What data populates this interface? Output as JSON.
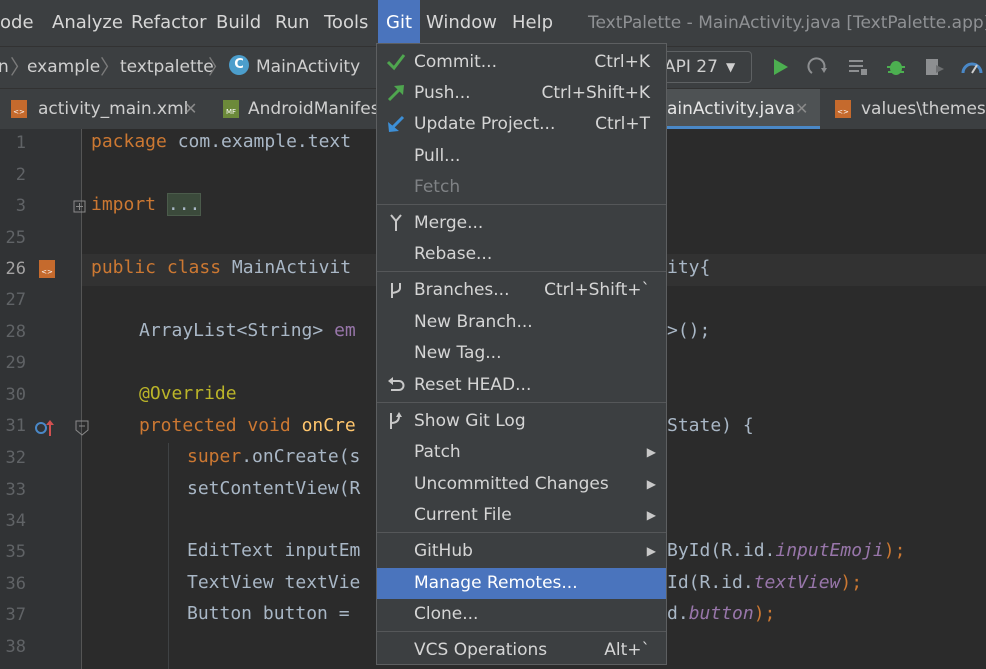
{
  "menubar": {
    "items": [
      "ode",
      "Analyze",
      "Refactor",
      "Build",
      "Run",
      "Tools",
      "Git",
      "Window",
      "Help"
    ],
    "window_title": "TextPalette - MainActivity.java [TextPalette.app] -"
  },
  "navbar": {
    "crumbs": [
      "n",
      "example",
      "textpalette",
      "MainActivity"
    ],
    "class_icon_letter": "C",
    "api_label": "API 27"
  },
  "tabs": [
    {
      "label": "activity_main.xml",
      "icon": "xml-file-icon"
    },
    {
      "label": "AndroidManifes",
      "icon": "manifest-file-icon"
    },
    {
      "label": "ainActivity.java",
      "icon": "java-file-icon",
      "active": true
    },
    {
      "label": "values\\themes",
      "icon": "xml-file-icon"
    }
  ],
  "editor": {
    "line_numbers": [
      "1",
      "2",
      "3",
      "25",
      "26",
      "27",
      "28",
      "29",
      "30",
      "31",
      "32",
      "33",
      "34",
      "35",
      "36",
      "37",
      "38"
    ],
    "lines": {
      "l1_kw": "package",
      "l1_rest": " com.example.text",
      "l3_kw": "import",
      "l3_fold": "...",
      "l26_kw": "public class",
      "l26_rest": " MainActivit",
      "l26_tail": "ity{",
      "l28": "ArrayList<String> ",
      "l28_field": "em",
      "l28_tail": ">();",
      "l30_ann": "@Override",
      "l31_kw": "protected void ",
      "l31_fn": "onCre",
      "l31_tail": "State) {",
      "l32_kw": "super",
      "l32_rest": ".onCreate(s",
      "l33": "setContentView(R",
      "l35": "EditText inputEm",
      "l35_tail1": "ById(R.id.",
      "l35_field": "inputEmoji",
      "l35_tail2": ");",
      "l36": "TextView textVie",
      "l36_tail1": "Id(R.id.",
      "l36_field": "textView",
      "l36_tail2": ");",
      "l37": "Button button = ",
      "l37_tail1": "d.",
      "l37_field": "button",
      "l37_tail2": ");"
    }
  },
  "git_menu": {
    "commit": {
      "label": "Commit...",
      "shortcut": "Ctrl+K"
    },
    "push": {
      "label": "Push...",
      "shortcut": "Ctrl+Shift+K"
    },
    "update": {
      "label": "Update Project...",
      "shortcut": "Ctrl+T"
    },
    "pull": {
      "label": "Pull..."
    },
    "fetch": {
      "label": "Fetch"
    },
    "merge": {
      "label": "Merge..."
    },
    "rebase": {
      "label": "Rebase..."
    },
    "branches": {
      "label": "Branches...",
      "shortcut": "Ctrl+Shift+`"
    },
    "new_branch": {
      "label": "New Branch..."
    },
    "new_tag": {
      "label": "New Tag..."
    },
    "reset_head": {
      "label": "Reset HEAD..."
    },
    "show_log": {
      "label": "Show Git Log"
    },
    "patch": {
      "label": "Patch"
    },
    "uncommitted": {
      "label": "Uncommitted Changes"
    },
    "current_file": {
      "label": "Current File"
    },
    "github": {
      "label": "GitHub"
    },
    "manage_remotes": {
      "label": "Manage Remotes..."
    },
    "clone": {
      "label": "Clone..."
    },
    "vcs_ops": {
      "label": "VCS Operations",
      "shortcut": "Alt+`"
    }
  },
  "colors": {
    "accent": "#4a74bd",
    "commit_green": "#4fa64f",
    "run_green": "#4caf50"
  }
}
